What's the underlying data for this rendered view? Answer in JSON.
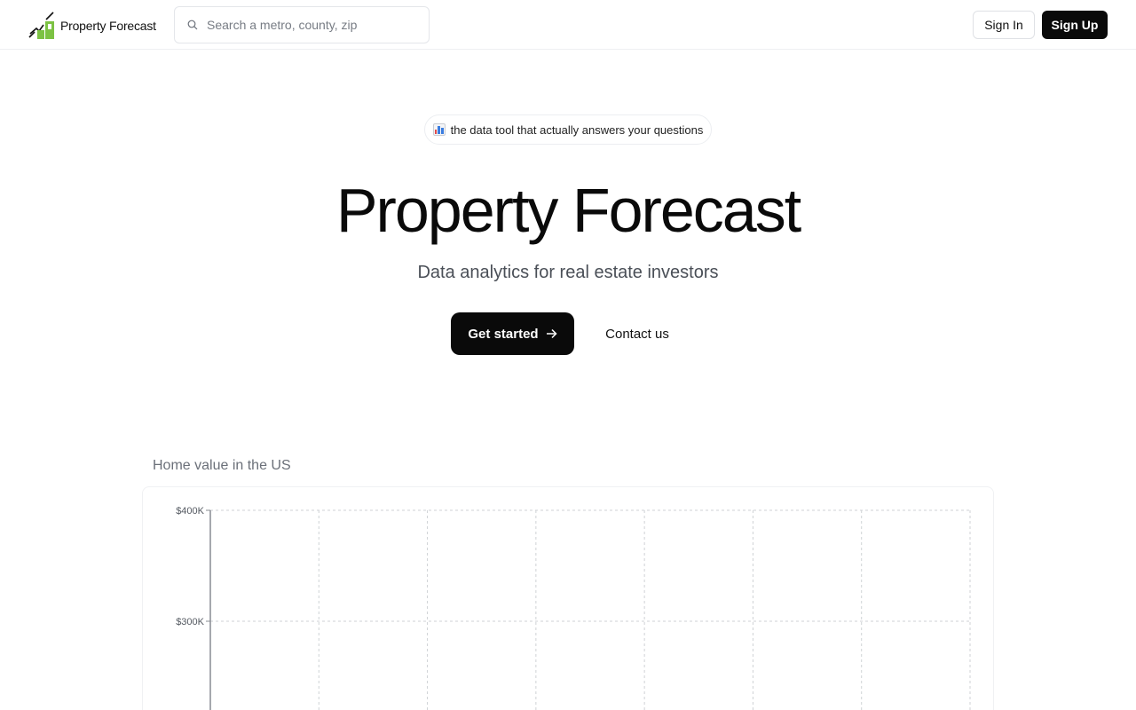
{
  "header": {
    "logo_text": "Property Forecast",
    "search_placeholder": "Search a metro, county, zip",
    "sign_in_label": "Sign In",
    "sign_up_label": "Sign Up"
  },
  "hero": {
    "pill_text": "the data tool that actually answers your questions",
    "title": "Property Forecast",
    "subtitle": "Data analytics for real estate investors",
    "get_started_label": "Get started",
    "contact_label": "Contact us"
  },
  "icons": {
    "logo": "property-forecast-logo-icon",
    "search": "search-icon",
    "pill": "bar-chart-icon",
    "cta": "arrow-right-icon"
  },
  "colors": {
    "primary": "#0a0a0a",
    "logo_green": "#7cc243",
    "muted_text": "#6b7079"
  },
  "chart_section": {
    "title": "Home value in the US"
  },
  "chart_data": {
    "type": "line",
    "title": "Home value in the US",
    "y_ticks": [
      "$400K",
      "$300K"
    ],
    "y_tick_values": [
      400000,
      300000
    ],
    "series": [],
    "grid": true
  }
}
